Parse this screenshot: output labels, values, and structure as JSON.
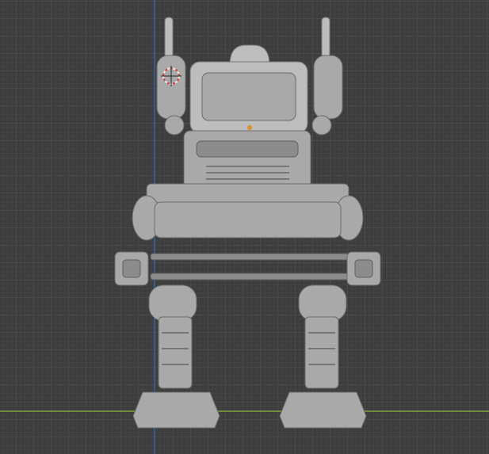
{
  "viewport": {
    "colors": {
      "background": "#3d3d3d",
      "grid": "#4a4a4a",
      "x_axis": "#6e8a3a",
      "y_axis": "#4a6a9a",
      "model": "#a9a9a9",
      "origin": "#e0902a"
    },
    "icons": [
      "3d-cursor-icon",
      "object-origin-icon"
    ]
  }
}
